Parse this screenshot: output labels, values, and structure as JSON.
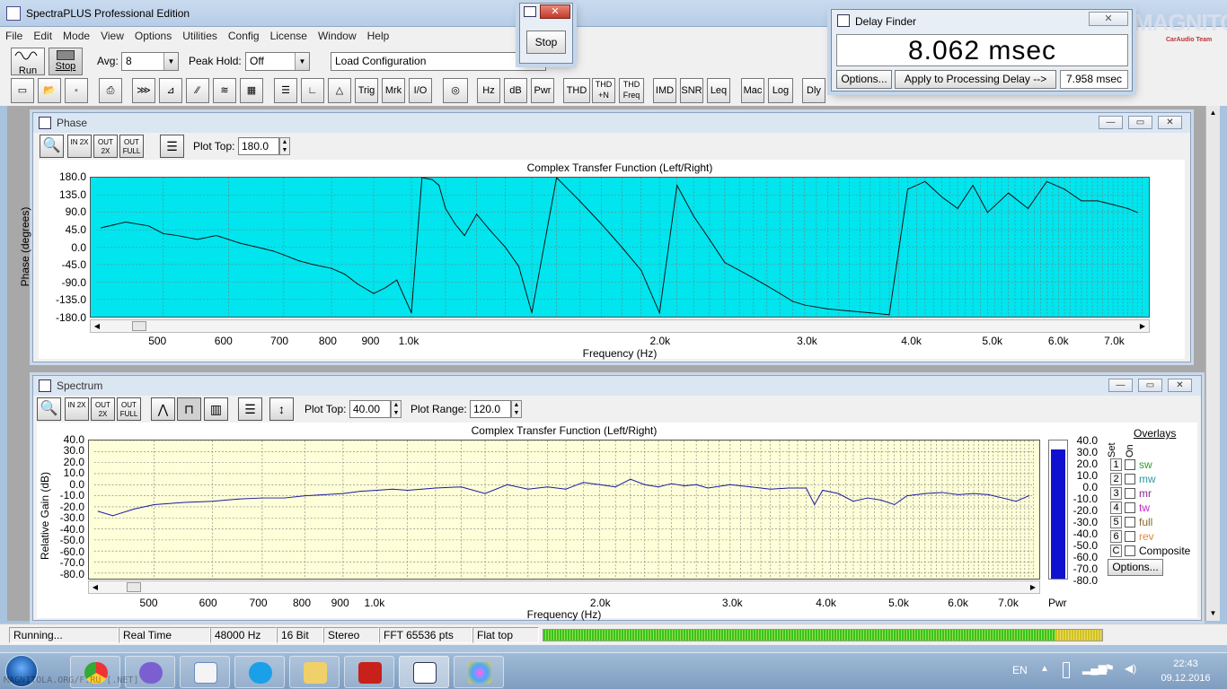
{
  "app": {
    "title": "SpectraPLUS Professional Edition"
  },
  "menu": [
    "File",
    "Edit",
    "Mode",
    "View",
    "Options",
    "Utilities",
    "Config",
    "License",
    "Window",
    "Help"
  ],
  "toolbar1": {
    "run": "Run",
    "stop": "Stop",
    "avg_label": "Avg:",
    "avg_value": "8",
    "peak_label": "Peak Hold:",
    "peak_value": "Off",
    "config_value": "Load Configuration"
  },
  "toolbar2": [
    "Trig",
    "Mrk",
    "I/O",
    "Hz",
    "dB",
    "Pwr",
    "THD",
    "THD +N",
    "THD Freq",
    "IMD",
    "SNR",
    "Leq",
    "Mac",
    "Log",
    "Dly"
  ],
  "stop_dialog": {
    "button": "Stop"
  },
  "delay_finder": {
    "title": "Delay Finder",
    "reading": "8.062 msec",
    "options": "Options...",
    "apply": "Apply to Processing Delay -->",
    "value": "7.958 msec"
  },
  "watermark": {
    "text": "MAGNITOLA",
    "sub": "CarAudio Team"
  },
  "phase": {
    "title": "Phase",
    "plot_top_label": "Plot Top:",
    "plot_top": "180.0",
    "buttons": [
      "IN 2X",
      "OUT 2X",
      "OUT FULL"
    ],
    "color": "#00e5ee"
  },
  "spectrum": {
    "title": "Spectrum",
    "plot_top_label": "Plot Top:",
    "plot_top": "40.00",
    "plot_range_label": "Plot Range:",
    "plot_range": "120.0",
    "buttons": [
      "IN 2X",
      "OUT 2X",
      "OUT FULL"
    ],
    "color": "#fefed8",
    "pwr": "Pwr"
  },
  "overlays": {
    "title": "Overlays",
    "set": "Set",
    "on": "On",
    "items": [
      {
        "n": "1",
        "label": "sw",
        "color": "#2aa02a"
      },
      {
        "n": "2",
        "label": "mw",
        "color": "#2a9aa0"
      },
      {
        "n": "3",
        "label": "mr",
        "color": "#8a2a8a"
      },
      {
        "n": "4",
        "label": "tw",
        "color": "#c828c8"
      },
      {
        "n": "5",
        "label": "full",
        "color": "#8a6a2a"
      },
      {
        "n": "6",
        "label": "rev",
        "color": "#e08a3a"
      },
      {
        "n": "C",
        "label": "Composite",
        "color": "#000000"
      }
    ],
    "options": "Options..."
  },
  "status": {
    "state": "Running...",
    "mode": "Real Time",
    "rate": "48000 Hz",
    "bits": "16 Bit",
    "channels": "Stereo",
    "fft": "FFT 65536 pts",
    "window": "Flat top"
  },
  "tray": {
    "lang": "EN",
    "time": "22:43",
    "date": "09.12.2016"
  },
  "taskbar_watermark": "MAGNITOLA.ORG/F.RU [.NET]",
  "chart_data": [
    {
      "type": "line",
      "title": "Complex Transfer Function (Left/Right)",
      "xlabel": "Frequency (Hz)",
      "ylabel": "Phase (degrees)",
      "ylim": [
        -180,
        180
      ],
      "xscale": "log",
      "x_ticks": [
        "500",
        "600",
        "700",
        "800",
        "900",
        "1.0k",
        "2.0k",
        "3.0k",
        "4.0k",
        "5.0k",
        "6.0k",
        "7.0k"
      ],
      "y_ticks": [
        "180.0",
        "135.0",
        "90.0",
        "45.0",
        "0.0",
        "-45.0",
        "-90.0",
        "-135.0",
        "-180.0"
      ],
      "x": [
        420,
        450,
        480,
        500,
        520,
        550,
        580,
        600,
        620,
        650,
        680,
        700,
        730,
        760,
        800,
        830,
        860,
        900,
        930,
        960,
        1000,
        1030,
        1060,
        1080,
        1100,
        1130,
        1160,
        1200,
        1250,
        1300,
        1350,
        1400,
        1500,
        1600,
        1700,
        1800,
        1900,
        2000,
        2100,
        2200,
        2300,
        2400,
        2500,
        2600,
        2700,
        2800,
        2900,
        3000,
        3200,
        3400,
        3600,
        3800,
        4000,
        4200,
        4400,
        4600,
        4800,
        5000,
        5300,
        5600,
        5900,
        6200,
        6500,
        6800,
        7100,
        7400,
        7600
      ],
      "y": [
        50,
        65,
        55,
        35,
        30,
        20,
        30,
        20,
        10,
        0,
        -10,
        -20,
        -35,
        -45,
        -55,
        -70,
        -95,
        -120,
        -105,
        -85,
        -170,
        180,
        175,
        160,
        100,
        60,
        30,
        85,
        40,
        0,
        -50,
        -170,
        180,
        120,
        60,
        0,
        -60,
        -170,
        160,
        80,
        20,
        -40,
        -60,
        -80,
        -100,
        -120,
        -140,
        -150,
        -160,
        -165,
        -170,
        -175,
        150,
        170,
        130,
        100,
        160,
        90,
        140,
        100,
        170,
        150,
        120,
        120,
        110,
        100,
        90
      ]
    },
    {
      "type": "line",
      "title": "Complex Transfer Function (Left/Right)",
      "xlabel": "Frequency (Hz)",
      "ylabel": "Relative Gain (dB)",
      "ylim": [
        -85,
        40
      ],
      "xscale": "log",
      "x_ticks": [
        "500",
        "600",
        "700",
        "800",
        "900",
        "1.0k",
        "2.0k",
        "3.0k",
        "4.0k",
        "5.0k",
        "6.0k",
        "7.0k"
      ],
      "y_ticks": [
        "40.0",
        "30.0",
        "20.0",
        "10.0",
        "0.0",
        "-10.0",
        "-20.0",
        "-30.0",
        "-40.0",
        "-50.0",
        "-60.0",
        "-70.0",
        "-80.0"
      ],
      "meter_ticks": [
        "40.0",
        "30.0",
        "20.0",
        "10.0",
        "0.0",
        "-10.0",
        "-20.0",
        "-30.0",
        "-40.0",
        "-50.0",
        "-60.0",
        "-70.0",
        "-80.0"
      ],
      "x": [
        420,
        440,
        470,
        500,
        550,
        600,
        650,
        700,
        750,
        800,
        850,
        900,
        950,
        1000,
        1050,
        1100,
        1150,
        1200,
        1300,
        1400,
        1500,
        1600,
        1700,
        1800,
        1900,
        2000,
        2100,
        2200,
        2300,
        2400,
        2500,
        2600,
        2700,
        2800,
        3000,
        3200,
        3400,
        3600,
        3800,
        3900,
        4000,
        4200,
        4400,
        4600,
        4800,
        5000,
        5200,
        5500,
        5800,
        6100,
        6400,
        6700,
        7000,
        7300,
        7600
      ],
      "y": [
        -24,
        -28,
        -22,
        -18,
        -16,
        -15,
        -13,
        -12,
        -12,
        -10,
        -9,
        -8,
        -6,
        -5,
        -4,
        -5,
        -4,
        -3,
        -2,
        -8,
        0,
        -4,
        -2,
        -4,
        2,
        0,
        -2,
        5,
        0,
        -2,
        1,
        -1,
        0,
        -3,
        0,
        -2,
        -4,
        -3,
        -3,
        -18,
        -5,
        -8,
        -15,
        -12,
        -14,
        -18,
        -10,
        -8,
        -7,
        -9,
        -8,
        -9,
        -12,
        -15,
        -10
      ]
    }
  ]
}
